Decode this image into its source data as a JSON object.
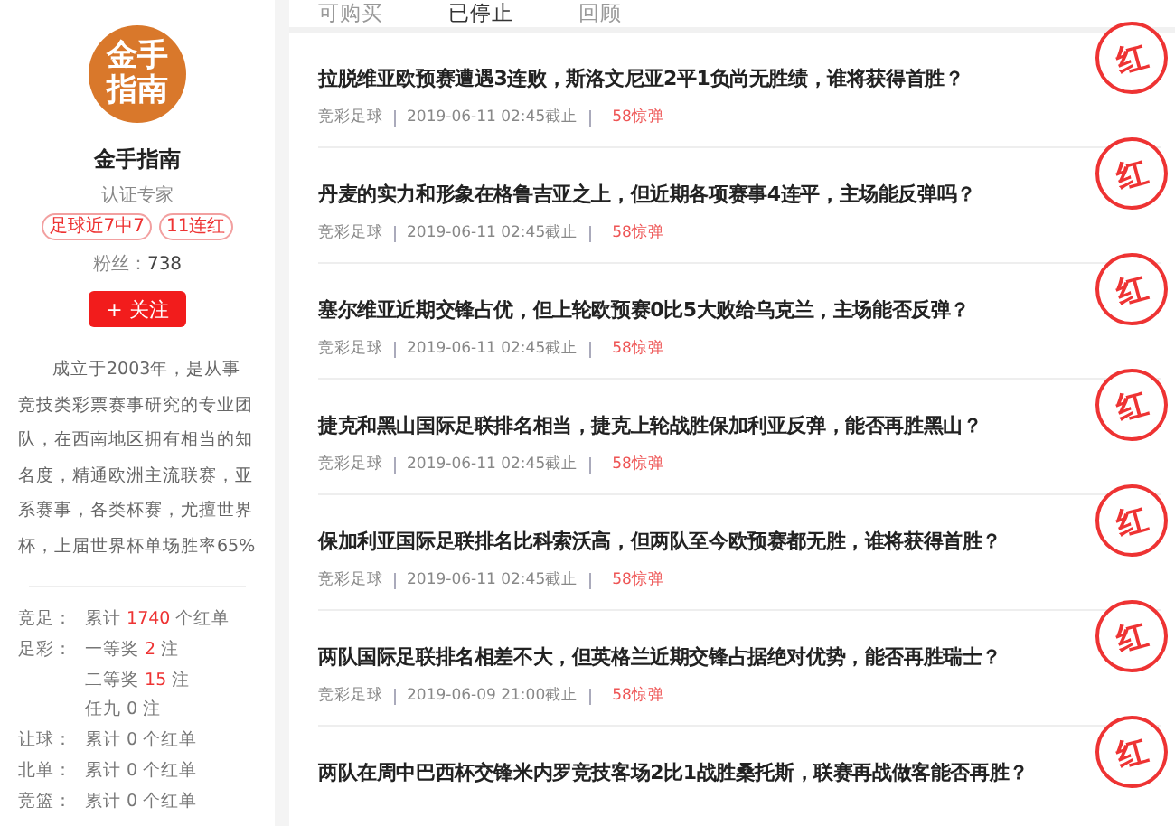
{
  "profile": {
    "logo_lines": [
      "金手",
      "指南"
    ],
    "name": "金手指南",
    "role": "认证专家",
    "badges": [
      "足球近7中7",
      "11连红"
    ],
    "fans_label": "粉丝：",
    "fans": "738",
    "follow_button": "+ 关注",
    "bio": "成立于2003年，是从事竞技类彩票赛事研究的专业团队，在西南地区拥有相当的知名度，精通欧洲主流联赛，亚系赛事，各类杯赛，尤擅世界杯，上届世界杯单场胜率65%"
  },
  "stats": [
    {
      "label": "竞足：",
      "prefix": "累计",
      "number": "1740",
      "suffix": "个红单",
      "highlight": true
    },
    {
      "label": "足彩：",
      "prefix": "一等奖",
      "number": "2",
      "suffix": "注",
      "highlight": true
    },
    {
      "prefix": "二等奖",
      "number": "15",
      "suffix": "注",
      "highlight": true
    },
    {
      "prefix": "任九",
      "number": "0",
      "suffix": "注",
      "highlight": false
    },
    {
      "label": "让球：",
      "prefix": "累计",
      "number": "0",
      "suffix": "个红单",
      "highlight": false
    },
    {
      "label": "北单：",
      "prefix": "累计",
      "number": "0",
      "suffix": "个红单",
      "highlight": false
    },
    {
      "label": "竞篮：",
      "prefix": "累计",
      "number": "0",
      "suffix": "个红单",
      "highlight": false
    }
  ],
  "tabs": [
    {
      "label": "可购买",
      "selected": false
    },
    {
      "label": "已停止",
      "selected": true
    },
    {
      "label": "回顾",
      "selected": false
    }
  ],
  "articles": [
    {
      "title": "拉脱维亚欧预赛遭遇3连败，斯洛文尼亚2平1负尚无胜绩，谁将获得首胜？",
      "category": "竞彩足球",
      "deadline": "2019-06-11 02:45截止",
      "price": "58惊弹",
      "result": "红"
    },
    {
      "title": "丹麦的实力和形象在格鲁吉亚之上，但近期各项赛事4连平，主场能反弹吗？",
      "category": "竞彩足球",
      "deadline": "2019-06-11 02:45截止",
      "price": "58惊弹",
      "result": "红"
    },
    {
      "title": "塞尔维亚近期交锋占优，但上轮欧预赛0比5大败给乌克兰，主场能否反弹？",
      "category": "竞彩足球",
      "deadline": "2019-06-11 02:45截止",
      "price": "58惊弹",
      "result": "红"
    },
    {
      "title": "捷克和黑山国际足联排名相当，捷克上轮战胜保加利亚反弹，能否再胜黑山？",
      "category": "竞彩足球",
      "deadline": "2019-06-11 02:45截止",
      "price": "58惊弹",
      "result": "红"
    },
    {
      "title": "保加利亚国际足联排名比科索沃高，但两队至今欧预赛都无胜，谁将获得首胜？",
      "category": "竞彩足球",
      "deadline": "2019-06-11 02:45截止",
      "price": "58惊弹",
      "result": "红"
    },
    {
      "title": "两队国际足联排名相差不大，但英格兰近期交锋占据绝对优势，能否再胜瑞士？",
      "category": "竞彩足球",
      "deadline": "2019-06-09 21:00截止",
      "price": "58惊弹",
      "result": "红"
    },
    {
      "title": "两队在周中巴西杯交锋米内罗竞技客场2比1战胜桑托斯，联赛再战做客能否再胜？",
      "result": "红"
    }
  ]
}
